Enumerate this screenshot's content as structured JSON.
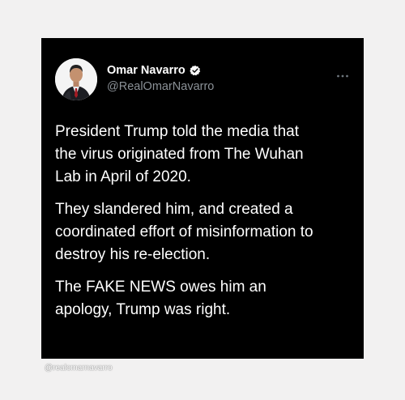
{
  "tweet": {
    "author": {
      "display_name": "Omar Navarro",
      "handle": "@RealOmarNavarro",
      "verified": true,
      "avatar_icon": "person-suit-avatar"
    },
    "more_icon": "ellipsis-icon",
    "paragraphs": [
      "President Trump told the media that\nthe virus originated from The Wuhan\nLab in April of 2020.",
      "They slandered him, and created a\ncoordinated effort of misinformation to\ndestroy his re-election.",
      "The FAKE NEWS owes him an\napology, Trump was right."
    ]
  },
  "watermark": "@realomarnavarro",
  "colors": {
    "page_background": "#f2f1f1",
    "card_background": "#000000",
    "text": "#ffffff",
    "handle": "#8b9197",
    "verified_badge": "#ffffff"
  }
}
